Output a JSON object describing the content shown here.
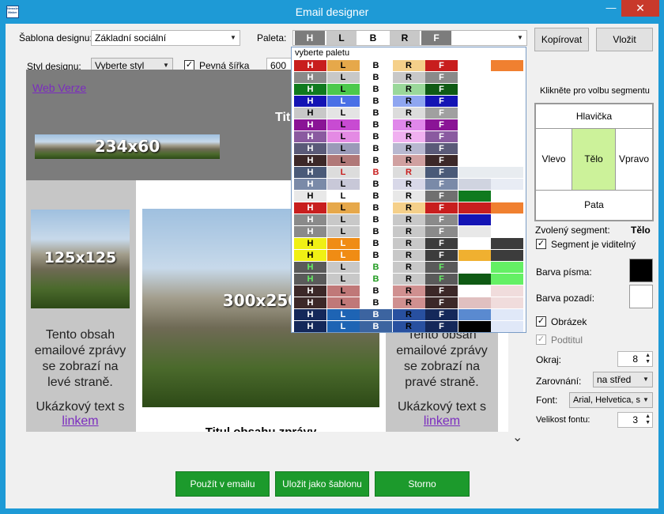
{
  "window": {
    "title": "Email designer",
    "app_icon_text": "Newsletter Maker",
    "minimize": "—",
    "close": "✕"
  },
  "top": {
    "template_label": "Šablona designu:",
    "template_value": "Základní sociální",
    "palette_label": "Paleta:",
    "palette_current": [
      "H",
      "L",
      "B",
      "R",
      "F"
    ],
    "copy_button": "Kopírovat",
    "paste_button": "Vložit",
    "style_label": "Styl designu:",
    "style_value": "Vyberte styl",
    "fixed_width_label": "Pevná šířka",
    "width_value": "600"
  },
  "palette_dropdown": {
    "header": "vyberte paletu",
    "rows": [
      {
        "letters": [
          "H",
          "L",
          "B",
          "R",
          "F"
        ],
        "bg": [
          "#c81e1e",
          "#e6a84a",
          "#ffffff",
          "#f5d08a",
          "#c81e1e",
          "#ffffff",
          "#f08030"
        ],
        "fg": [
          "#fff",
          "#000",
          "#000",
          "#000",
          "#fff"
        ]
      },
      {
        "letters": [
          "H",
          "L",
          "B",
          "R",
          "F"
        ],
        "bg": [
          "#8a8a8a",
          "#c8c8c8",
          "#ffffff",
          "#c8c8c8",
          "#8a8a8a",
          "#ffffff",
          "#ffffff"
        ],
        "fg": [
          "#fff",
          "#000",
          "#000",
          "#000",
          "#fff"
        ]
      },
      {
        "letters": [
          "H",
          "L",
          "B",
          "R",
          "F"
        ],
        "bg": [
          "#0f7a1e",
          "#4cc94c",
          "#ffffff",
          "#9ad89a",
          "#0f5a14",
          "#ffffff",
          "#ffffff"
        ],
        "fg": [
          "#fff",
          "#000",
          "#000",
          "#000",
          "#fff"
        ]
      },
      {
        "letters": [
          "H",
          "L",
          "B",
          "R",
          "F"
        ],
        "bg": [
          "#1414b4",
          "#4a70e6",
          "#ffffff",
          "#8fa6f0",
          "#1414b4",
          "#ffffff",
          "#ffffff"
        ],
        "fg": [
          "#fff",
          "#fff",
          "#000",
          "#000",
          "#fff"
        ]
      },
      {
        "letters": [
          "H",
          "L",
          "B",
          "R",
          "F"
        ],
        "bg": [
          "#c8c8c8",
          "#e4e4e4",
          "#ffffff",
          "#dcdcdc",
          "#a0a0a0",
          "#ffffff",
          "#ffffff"
        ],
        "fg": [
          "#000",
          "#000",
          "#000",
          "#000",
          "#fff"
        ]
      },
      {
        "letters": [
          "H",
          "L",
          "B",
          "R",
          "F"
        ],
        "bg": [
          "#8a1496",
          "#c84bd2",
          "#ffffff",
          "#e088ea",
          "#8a1496",
          "#ffffff",
          "#ffffff"
        ],
        "fg": [
          "#fff",
          "#000",
          "#000",
          "#000",
          "#fff"
        ]
      },
      {
        "letters": [
          "H",
          "L",
          "B",
          "R",
          "F"
        ],
        "bg": [
          "#8a5aa0",
          "#e48ae4",
          "#ffffff",
          "#f0b0f0",
          "#8a5aa0",
          "#ffffff",
          "#ffffff"
        ],
        "fg": [
          "#fff",
          "#000",
          "#000",
          "#000",
          "#fff"
        ]
      },
      {
        "letters": [
          "H",
          "L",
          "B",
          "R",
          "F"
        ],
        "bg": [
          "#5a5a78",
          "#9a9ab8",
          "#ffffff",
          "#b8b8d0",
          "#5a5a78",
          "#ffffff",
          "#ffffff"
        ],
        "fg": [
          "#fff",
          "#000",
          "#000",
          "#000",
          "#fff"
        ]
      },
      {
        "letters": [
          "H",
          "L",
          "B",
          "R",
          "F"
        ],
        "bg": [
          "#3c2828",
          "#b07878",
          "#ffffff",
          "#d0a0a0",
          "#3c2828",
          "#ffffff",
          "#ffffff"
        ],
        "fg": [
          "#fff",
          "#000",
          "#000",
          "#000",
          "#fff"
        ]
      },
      {
        "letters": [
          "H",
          "L",
          "B",
          "R",
          "F"
        ],
        "bg": [
          "#4a5a78",
          "#dcdcdc",
          "#ffffff",
          "#dcdcdc",
          "#4a5a78",
          "#e8ecf0",
          "#e8ecf0"
        ],
        "fg": [
          "#fff",
          "#c81e1e",
          "#c81e1e",
          "#c81e1e",
          "#fff"
        ]
      },
      {
        "letters": [
          "H",
          "L",
          "B",
          "R",
          "F"
        ],
        "bg": [
          "#7a8aa8",
          "#c8c8d8",
          "#ffffff",
          "#d8d8e8",
          "#7a8aa8",
          "#d0d4e0",
          "#e8ecf4"
        ],
        "fg": [
          "#fff",
          "#000",
          "#000",
          "#000",
          "#fff"
        ]
      },
      {
        "letters": [
          "H",
          "L",
          "B",
          "R",
          "F"
        ],
        "bg": [
          "#e8e8e8",
          "#ffffff",
          "#ffffff",
          "#e8e8e8",
          "#707070",
          "#0f7a1e",
          "#ffffff"
        ],
        "fg": [
          "#000",
          "#000",
          "#000",
          "#000",
          "#fff"
        ]
      },
      {
        "letters": [
          "H",
          "L",
          "B",
          "R",
          "F"
        ],
        "bg": [
          "#c81e1e",
          "#e6a84a",
          "#ffffff",
          "#f5d08a",
          "#c81e1e",
          "#c81e1e",
          "#f08030"
        ],
        "fg": [
          "#fff",
          "#000",
          "#000",
          "#000",
          "#fff"
        ]
      },
      {
        "letters": [
          "H",
          "L",
          "B",
          "R",
          "F"
        ],
        "bg": [
          "#8a8a8a",
          "#c8c8c8",
          "#ffffff",
          "#c8c8c8",
          "#8a8a8a",
          "#1414b4",
          "#ffffff"
        ],
        "fg": [
          "#fff",
          "#000",
          "#000",
          "#000",
          "#fff"
        ]
      },
      {
        "letters": [
          "H",
          "L",
          "B",
          "R",
          "F"
        ],
        "bg": [
          "#8a8a8a",
          "#c8c8c8",
          "#ffffff",
          "#c8c8c8",
          "#8a8a8a",
          "#e8e8e8",
          "#ffffff"
        ],
        "fg": [
          "#fff",
          "#000",
          "#000",
          "#000",
          "#fff"
        ]
      },
      {
        "letters": [
          "H",
          "L",
          "B",
          "R",
          "F"
        ],
        "bg": [
          "#f0f014",
          "#f08c14",
          "#ffffff",
          "#c8c8c8",
          "#3c3c3c",
          "#ffffff",
          "#3c3c3c"
        ],
        "fg": [
          "#000",
          "#fff",
          "#000",
          "#000",
          "#fff"
        ]
      },
      {
        "letters": [
          "H",
          "L",
          "B",
          "R",
          "F"
        ],
        "bg": [
          "#f0f014",
          "#f08c14",
          "#ffffff",
          "#c8c8c8",
          "#3c3c3c",
          "#f0b030",
          "#3c3c3c"
        ],
        "fg": [
          "#000",
          "#fff",
          "#000",
          "#000",
          "#fff"
        ]
      },
      {
        "letters": [
          "H",
          "L",
          "B",
          "R",
          "F"
        ],
        "bg": [
          "#5a5a5a",
          "#c8c8c8",
          "#ffffff",
          "#c8c8c8",
          "#5a5a5a",
          "#ffffff",
          "#64f064"
        ],
        "fg": [
          "#64f064",
          "#000",
          "#1e9a1e",
          "#000",
          "#64f064"
        ]
      },
      {
        "letters": [
          "H",
          "L",
          "B",
          "R",
          "F"
        ],
        "bg": [
          "#5a5a5a",
          "#c8c8c8",
          "#ffffff",
          "#c8c8c8",
          "#5a5a5a",
          "#0f5a14",
          "#64f064"
        ],
        "fg": [
          "#64f064",
          "#000",
          "#1e9a1e",
          "#000",
          "#64f064"
        ]
      },
      {
        "letters": [
          "H",
          "L",
          "B",
          "R",
          "F"
        ],
        "bg": [
          "#3c2828",
          "#c07878",
          "#ffffff",
          "#d09090",
          "#3c2828",
          "#ffffff",
          "#f0dcdc"
        ],
        "fg": [
          "#fff",
          "#000",
          "#000",
          "#000",
          "#fff"
        ]
      },
      {
        "letters": [
          "H",
          "L",
          "B",
          "R",
          "F"
        ],
        "bg": [
          "#3c2828",
          "#c07878",
          "#ffffff",
          "#d09090",
          "#3c2828",
          "#e0c0c0",
          "#f0dcdc"
        ],
        "fg": [
          "#fff",
          "#000",
          "#000",
          "#000",
          "#fff"
        ]
      },
      {
        "letters": [
          "H",
          "L",
          "B",
          "R",
          "F"
        ],
        "bg": [
          "#14285a",
          "#1e64b4",
          "#3c64a0",
          "#2850a0",
          "#14285a",
          "#5a8ad0",
          "#e0e8f8"
        ],
        "fg": [
          "#fff",
          "#fff",
          "#fff",
          "#000",
          "#fff"
        ]
      },
      {
        "letters": [
          "H",
          "L",
          "B",
          "R",
          "F"
        ],
        "bg": [
          "#14285a",
          "#1e64b4",
          "#3c64a0",
          "#2850a0",
          "#14285a",
          "#000000",
          "#e0e8f8"
        ],
        "fg": [
          "#fff",
          "#fff",
          "#fff",
          "#000",
          "#fff"
        ]
      }
    ]
  },
  "preview": {
    "web_link": "Web Verze",
    "header_image_label": "234x60",
    "header_title": "Titulek",
    "left_image_label": "125x125",
    "center_image_label": "300x250",
    "left_text": "Tento obsah emailové zprávy se zobrazí na levé straně.",
    "sample_text": "Ukázkový text s",
    "link_text": "linkem",
    "right_text": "Tento obsah emailové zprávy se zobrazí na pravé straně.",
    "content_title": "Titul obsahu zprávy",
    "scroll_down": "⌄"
  },
  "panel": {
    "click_label": "Klikněte pro volbu segmentu",
    "seg_header": "Hlavička",
    "seg_left": "Vlevo",
    "seg_body": "Tělo",
    "seg_right": "Vpravo",
    "seg_footer": "Pata",
    "selected_label": "Zvolený segment:",
    "selected_value": "Tělo",
    "visible_label": "Segment je viditelný",
    "font_color_label": "Barva písma:",
    "font_color": "#000000",
    "bg_color_label": "Barva pozadí:",
    "bg_color": "#ffffff",
    "image_label": "Obrázek",
    "caption_label": "Podtitul",
    "margin_label": "Okraj:",
    "margin_value": "8",
    "align_label": "Zarovnání:",
    "align_value": "na střed",
    "font_label": "Font:",
    "font_value": "Arial, Helvetica, s",
    "font_size_label": "Velikost fontu:",
    "font_size_value": "3"
  },
  "bottom": {
    "use_button": "Použít v emailu",
    "save_button": "Uložit jako šablonu",
    "cancel_button": "Storno"
  }
}
